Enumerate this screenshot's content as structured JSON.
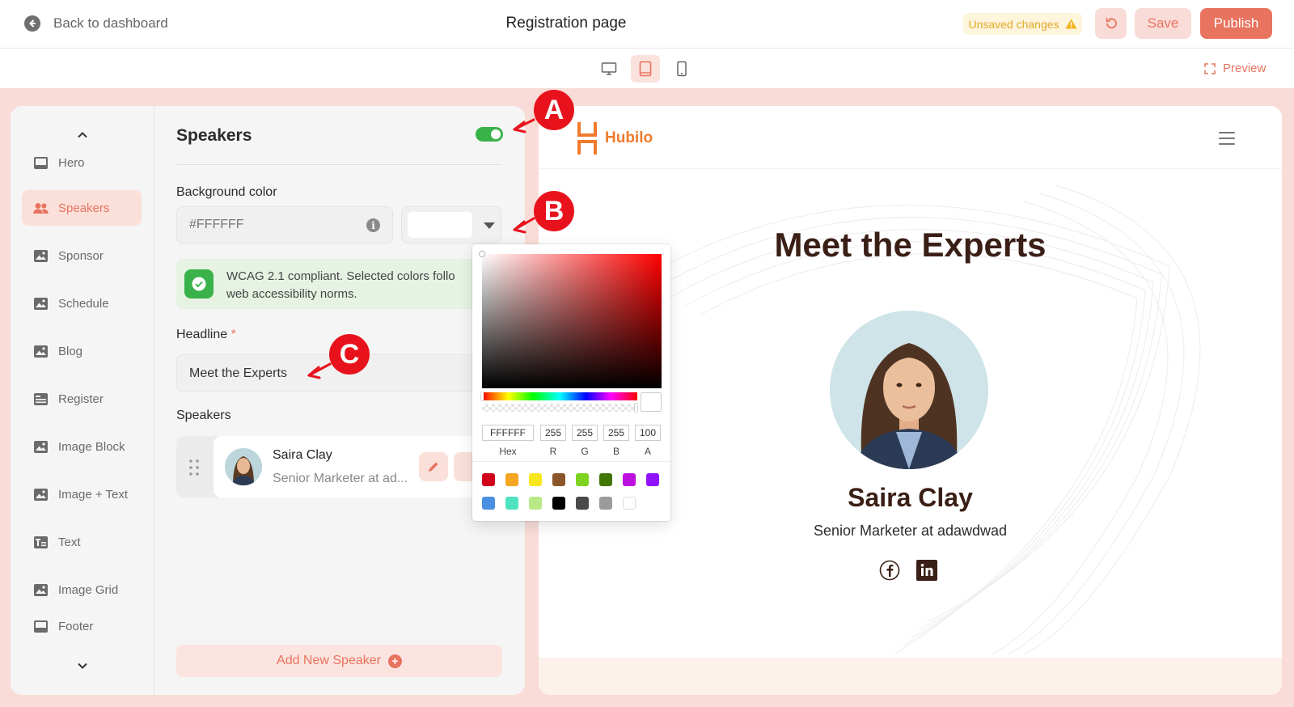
{
  "topbar": {
    "back_label": "Back to dashboard",
    "title": "Registration page",
    "unsaved_label": "Unsaved changes",
    "save_label": "Save",
    "publish_label": "Publish"
  },
  "devicebar": {
    "devices": [
      "desktop",
      "tablet",
      "mobile"
    ],
    "active_device": "tablet",
    "preview_label": "Preview"
  },
  "sidebar": {
    "items": [
      {
        "label": "Hero",
        "icon": "hero-icon"
      },
      {
        "label": "Speakers",
        "icon": "people-icon"
      },
      {
        "label": "Sponsor",
        "icon": "image-icon"
      },
      {
        "label": "Schedule",
        "icon": "image-icon"
      },
      {
        "label": "Blog",
        "icon": "image-icon"
      },
      {
        "label": "Register",
        "icon": "form-icon"
      },
      {
        "label": "Image Block",
        "icon": "image-icon"
      },
      {
        "label": "Image + Text",
        "icon": "image-icon"
      },
      {
        "label": "Text",
        "icon": "text-icon"
      },
      {
        "label": "Image Grid",
        "icon": "image-icon"
      },
      {
        "label": "Footer",
        "icon": "footer-icon"
      }
    ],
    "active_item": "Speakers"
  },
  "panel": {
    "title": "Speakers",
    "enabled": true,
    "bg_label": "Background color",
    "bg_value": "#FFFFFF",
    "wcag_text": "WCAG 2.1 compliant. Selected colors follo\nweb accessibility norms.",
    "headline_label": "Headline",
    "required_mark": "*",
    "headline_value": "Meet the Experts",
    "speakers_label": "Speakers",
    "speaker": {
      "name": "Saira Clay",
      "role": "Senior Marketer at ad..."
    },
    "add_label": "Add New Speaker"
  },
  "picker": {
    "hex": "FFFFFF",
    "r": "255",
    "g": "255",
    "b": "255",
    "a": "100",
    "labels": {
      "hex": "Hex",
      "r": "R",
      "g": "G",
      "b": "B",
      "a": "A"
    },
    "presets": [
      "#d0021b",
      "#f5a623",
      "#f8e71c",
      "#8b572a",
      "#7ed321",
      "#417505",
      "#bd10e0",
      "#9013fe",
      "#4a90e2",
      "#50e3c2",
      "#b8e986",
      "#000000",
      "#4a4a4a",
      "#9b9b9b",
      "#ffffff"
    ]
  },
  "canvas": {
    "brand": "Hubilo",
    "headline": "Meet the Experts",
    "speaker_name": "Saira Clay",
    "speaker_role": "Senior Marketer at adawdwad",
    "socials": [
      "facebook-icon",
      "linkedin-icon"
    ]
  },
  "annotations": [
    "A",
    "B",
    "C"
  ],
  "colors": {
    "accent": "#e8735f",
    "toggle": "#3ab24a",
    "annotation": "#e8121c",
    "brand": "#f07b2c",
    "heading": "#3a1f16"
  }
}
